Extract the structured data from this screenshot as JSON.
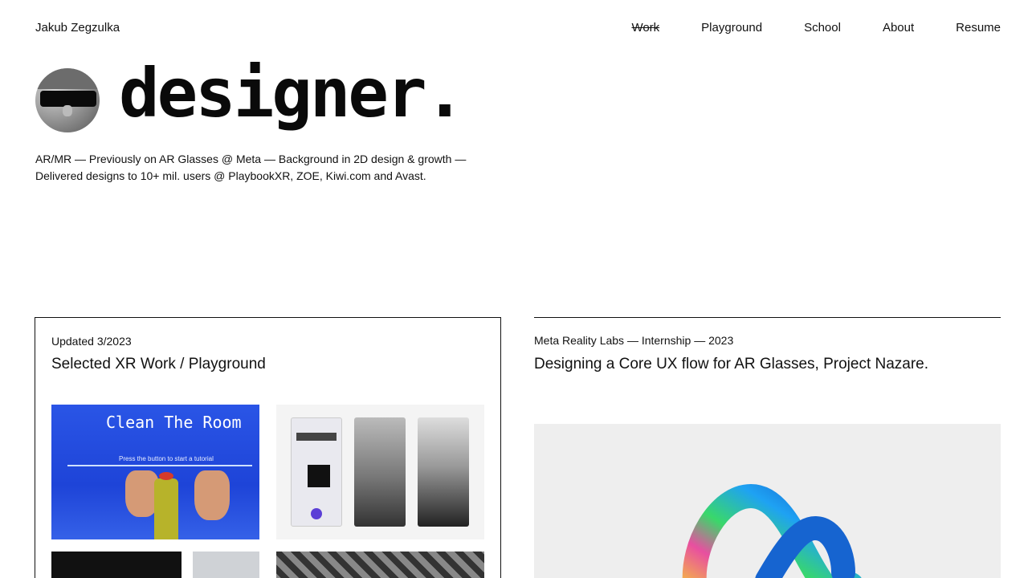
{
  "header": {
    "brand": "Jakub Zegzulka",
    "nav": [
      "Work",
      "Playground",
      "School",
      "About",
      "Resume"
    ],
    "active": "Work"
  },
  "hero": {
    "headline": "designer.",
    "bio": "AR/MR — Previously on AR Glasses @ Meta — Background in 2D design & growth — Delivered designs to 10+ mil. users @ PlaybookXR, ZOE, Kiwi.com and Avast."
  },
  "cards": [
    {
      "meta": "Updated 3/2023",
      "title": "Selected XR Work / Playground",
      "thumb1_title": "Clean The Room",
      "thumb1_subtitle": "Press the button to start a tutorial"
    },
    {
      "meta": "Meta Reality Labs — Internship — 2023",
      "title": "Designing a Core UX flow for AR Glasses, Project Nazare."
    }
  ]
}
